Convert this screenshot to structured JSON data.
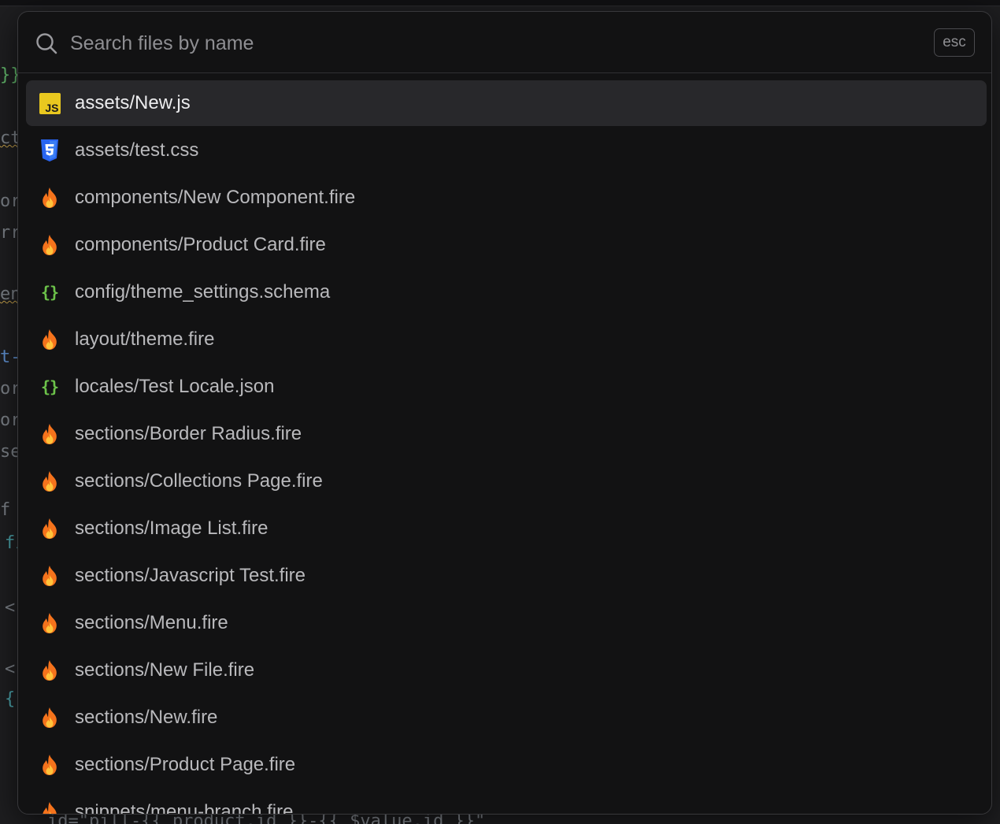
{
  "backdrop": {
    "fragments": [
      "}}",
      "ct",
      "or",
      "rr",
      "en",
      "t-",
      "or",
      "or",
      "se",
      "f",
      "fi",
      "<",
      "<",
      "{"
    ],
    "bottom_code": "id=\"pill-{{ product.id }}-{{ $value.id }}\""
  },
  "search": {
    "placeholder": "Search files by name",
    "value": "",
    "icon": "search-icon",
    "esc_label": "esc"
  },
  "results": [
    {
      "label": "assets/New.js",
      "icon": "js-icon",
      "selected": true
    },
    {
      "label": "assets/test.css",
      "icon": "css3-icon",
      "selected": false
    },
    {
      "label": "components/New Component.fire",
      "icon": "fire-icon",
      "selected": false
    },
    {
      "label": "components/Product Card.fire",
      "icon": "fire-icon",
      "selected": false
    },
    {
      "label": "config/theme_settings.schema",
      "icon": "braces-icon",
      "selected": false
    },
    {
      "label": "layout/theme.fire",
      "icon": "fire-icon",
      "selected": false
    },
    {
      "label": "locales/Test Locale.json",
      "icon": "braces-icon",
      "selected": false
    },
    {
      "label": "sections/Border Radius.fire",
      "icon": "fire-icon",
      "selected": false
    },
    {
      "label": "sections/Collections Page.fire",
      "icon": "fire-icon",
      "selected": false
    },
    {
      "label": "sections/Image List.fire",
      "icon": "fire-icon",
      "selected": false
    },
    {
      "label": "sections/Javascript Test.fire",
      "icon": "fire-icon",
      "selected": false
    },
    {
      "label": "sections/Menu.fire",
      "icon": "fire-icon",
      "selected": false
    },
    {
      "label": "sections/New File.fire",
      "icon": "fire-icon",
      "selected": false
    },
    {
      "label": "sections/New.fire",
      "icon": "fire-icon",
      "selected": false
    },
    {
      "label": "sections/Product Page.fire",
      "icon": "fire-icon",
      "selected": false
    },
    {
      "label": "snippets/menu-branch.fire",
      "icon": "fire-icon",
      "selected": false
    }
  ],
  "colors": {
    "js_badge": "#e9c81f",
    "css_badge": "#2965f1",
    "fire_outer": "#f5731c",
    "fire_inner": "#ffc43b",
    "braces": "#6cc24a",
    "selected_row": "#28282b"
  }
}
